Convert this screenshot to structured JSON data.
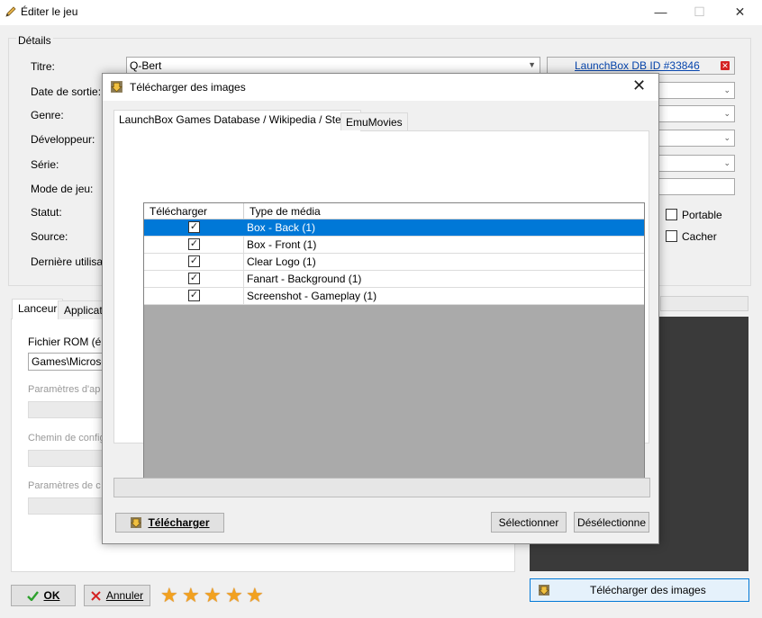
{
  "main_window": {
    "title": "Éditer le jeu",
    "minimize_glyph": "—",
    "maximize_glyph": "☐",
    "close_glyph": "✕",
    "details_group": "Détails",
    "labels": {
      "title": "Titre:",
      "release_date": "Date de sortie:",
      "genre": "Genre:",
      "developer": "Développeur:",
      "series": "Série:",
      "play_mode": "Mode de jeu:",
      "status": "Statut:",
      "source": "Source:",
      "last_played": "Dernière utilisat"
    },
    "title_value": "Q-Bert",
    "launchbox_link": "LaunchBox DB ID #33846",
    "checkboxes": {
      "portable": {
        "label": "Portable",
        "checked": false
      },
      "hide": {
        "label": "Cacher",
        "checked": false
      }
    },
    "lower_tabs": {
      "launcher": "Lanceur",
      "applications": "Applicatio"
    },
    "lower": {
      "rom_file_label": "Fichier ROM (ém",
      "rom_file_value": "Games\\Microsof",
      "app_params_label": "Paramètres d'ap",
      "config_path_label": "Chemin de config",
      "params_label": "Paramètres de c"
    },
    "buttons": {
      "ok": "OK",
      "cancel": "Annuler",
      "download_images": "Télécharger des images"
    },
    "rating_stars": 5
  },
  "dialog": {
    "title": "Télécharger des images",
    "close_glyph": "✕",
    "tabs": [
      {
        "label": "LaunchBox Games Database / Wikipedia / Steam",
        "active": true
      },
      {
        "label": "EmuMovies",
        "active": false
      }
    ],
    "grid": {
      "headers": {
        "download": "Télécharger",
        "media_type": "Type de média"
      },
      "rows": [
        {
          "checked": true,
          "label": "Box - Back (1)",
          "selected": true
        },
        {
          "checked": true,
          "label": "Box - Front (1)",
          "selected": false
        },
        {
          "checked": true,
          "label": "Clear Logo (1)",
          "selected": false
        },
        {
          "checked": true,
          "label": "Fanart - Background (1)",
          "selected": false
        },
        {
          "checked": true,
          "label": "Screenshot - Gameplay (1)",
          "selected": false
        }
      ]
    },
    "buttons": {
      "download": "Télécharger",
      "select": "Sélectionner",
      "deselect": "Désélectionne"
    }
  },
  "colors": {
    "selection": "#0078d7",
    "star": "#f2a11f",
    "link": "#0645ad",
    "ok_check": "#2ea12e",
    "cancel_x": "#d42222"
  }
}
